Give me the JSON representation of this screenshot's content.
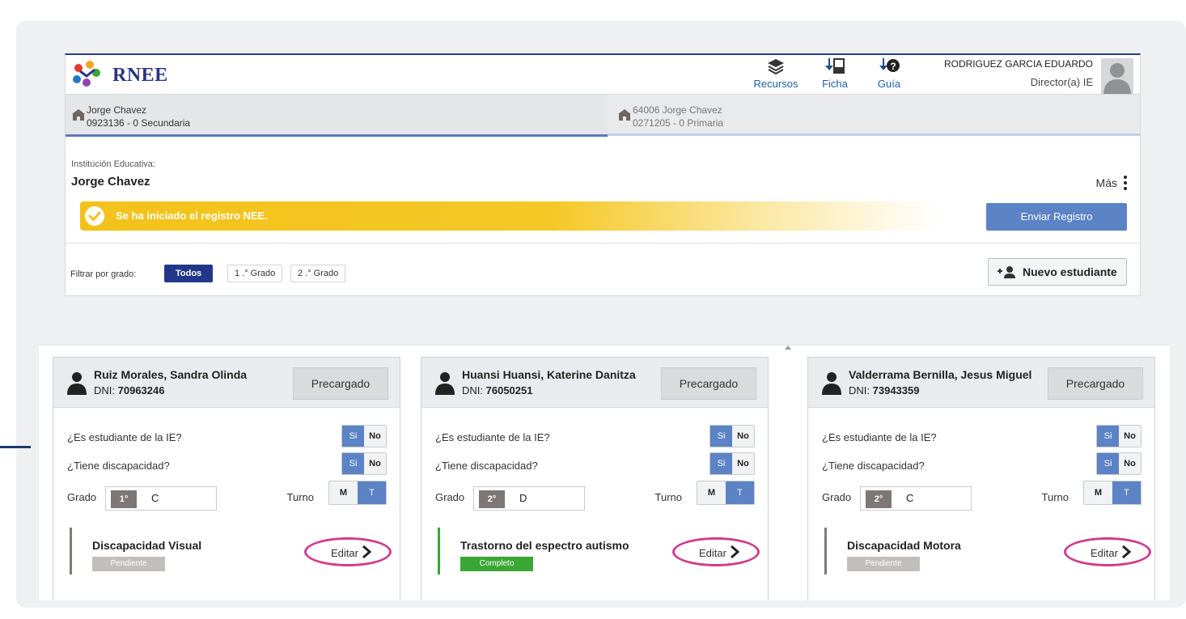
{
  "header": {
    "brand": "RNEE",
    "tools": [
      {
        "label": "Recursos",
        "icon": "layers-icon"
      },
      {
        "label": "Ficha",
        "icon": "pdf-download-icon"
      },
      {
        "label": "Guía",
        "icon": "help-download-icon"
      }
    ],
    "user": {
      "name": "RODRIGUEZ GARCIA EDUARDO",
      "role": "Director(a) IE"
    }
  },
  "schools": [
    {
      "name": "Jorge Chavez",
      "code": "0923136 - 0   Secundaria",
      "active": true
    },
    {
      "name": "64006 Jorge Chavez",
      "code": "0271205 - 0   Primaria",
      "active": false
    }
  ],
  "institution": {
    "label": "Institución Educativa:",
    "name": "Jorge Chavez",
    "more_label": "Más"
  },
  "banner": {
    "message": "Se ha iniciado el registro NEE.",
    "send_label": "Enviar Registro"
  },
  "filter": {
    "label": "Filtrar por grado:",
    "options": [
      "Todos",
      "1 .° Grado",
      "2 .° Grado"
    ],
    "selected": "Todos"
  },
  "new_student_label": "Nuevo estudiante",
  "colors": {
    "accent": "#23378a",
    "toggle_on": "#5b83c6",
    "banner": "#f3c21a",
    "complete": "#3aa635",
    "pending": "#c2bfbb",
    "highlight": "#d13c8a"
  },
  "card_labels": {
    "dni_prefix": "DNI:",
    "q_student": "¿Es estudiante de la IE?",
    "q_disability": "¿Tiene discapacidad?",
    "yes": "Si",
    "no": "No",
    "grade_label": "Grado",
    "shift_label": "Turno",
    "shift_m": "M",
    "shift_t": "T",
    "edit_label": "Editar"
  },
  "students": [
    {
      "name": "Ruiz Morales, Sandra Olinda",
      "dni": "70963246",
      "tag": "Precargado",
      "grade": "1°",
      "section": "C",
      "disability": "Discapacidad Visual",
      "status": "Pendiente",
      "status_color": "#c2bfbb",
      "bar_color": "#7f7a77"
    },
    {
      "name": "Huansi Huansi, Katerine Danitza",
      "dni": "76050251",
      "tag": "Precargado",
      "grade": "2°",
      "section": "D",
      "disability": "Trastorno del espectro autismo",
      "status": "Completo",
      "status_color": "#3aa635",
      "bar_color": "#3aa635"
    },
    {
      "name": "Valderrama Bernilla, Jesus Miguel",
      "dni": "73943359",
      "tag": "Precargado",
      "grade": "2°",
      "section": "C",
      "disability": "Discapacidad Motora",
      "status": "Pendiente",
      "status_color": "#c2bfbb",
      "bar_color": "#7f7a77"
    }
  ]
}
